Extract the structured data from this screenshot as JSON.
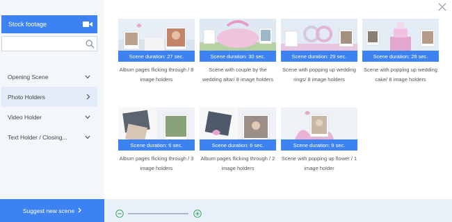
{
  "sidebar": {
    "stock_button_label": "Stock footage",
    "stock_button_icon": "video-camera-icon",
    "search": {
      "value": "",
      "placeholder": ""
    },
    "items": [
      {
        "label": "Opening Scene",
        "icon": "chevron-down-icon",
        "active": false
      },
      {
        "label": "Photo Holders",
        "icon": "chevron-right-icon",
        "active": true
      },
      {
        "label": "Video Holder",
        "icon": "chevron-down-icon",
        "active": false
      },
      {
        "label": "Text Holder / Closing...",
        "icon": "chevron-down-icon",
        "active": false
      }
    ],
    "suggest_label": "Suggest new scene"
  },
  "colors": {
    "accent": "#3d82f3",
    "sidebar_bg": "#f3f6fa",
    "active_bg": "#e3ecf8",
    "bottom_bg": "#e9f0f9"
  },
  "scenes": [
    {
      "duration": "Scene duration: 27 sec.",
      "caption": "Album pages flicking through / 8 image holders"
    },
    {
      "duration": "Scene duration: 30 sec.",
      "caption": "Scene with couple by the wedding altar/ 8 image holders"
    },
    {
      "duration": "Scene duration: 29 sec.",
      "caption": "Scene with popping up wedding rings/ 8 image holders"
    },
    {
      "duration": "Scene duration: 28 sec.",
      "caption": "Scene with popping up wedding cake/ 8 image holders"
    },
    {
      "duration": "Scene duration: 6 sec.",
      "caption": "Album pages flicking through / 3 image holders"
    },
    {
      "duration": "Scene duration: 6 sec.",
      "caption": "Album pages flicking through / 2 image holders"
    },
    {
      "duration": "Scene duration: 9 sec.",
      "caption": "Scene with popping up flower / 1 image holder"
    }
  ],
  "zoom": {
    "out_icon": "zoom-out-icon",
    "in_icon": "zoom-in-icon"
  },
  "close_icon": "close-icon"
}
